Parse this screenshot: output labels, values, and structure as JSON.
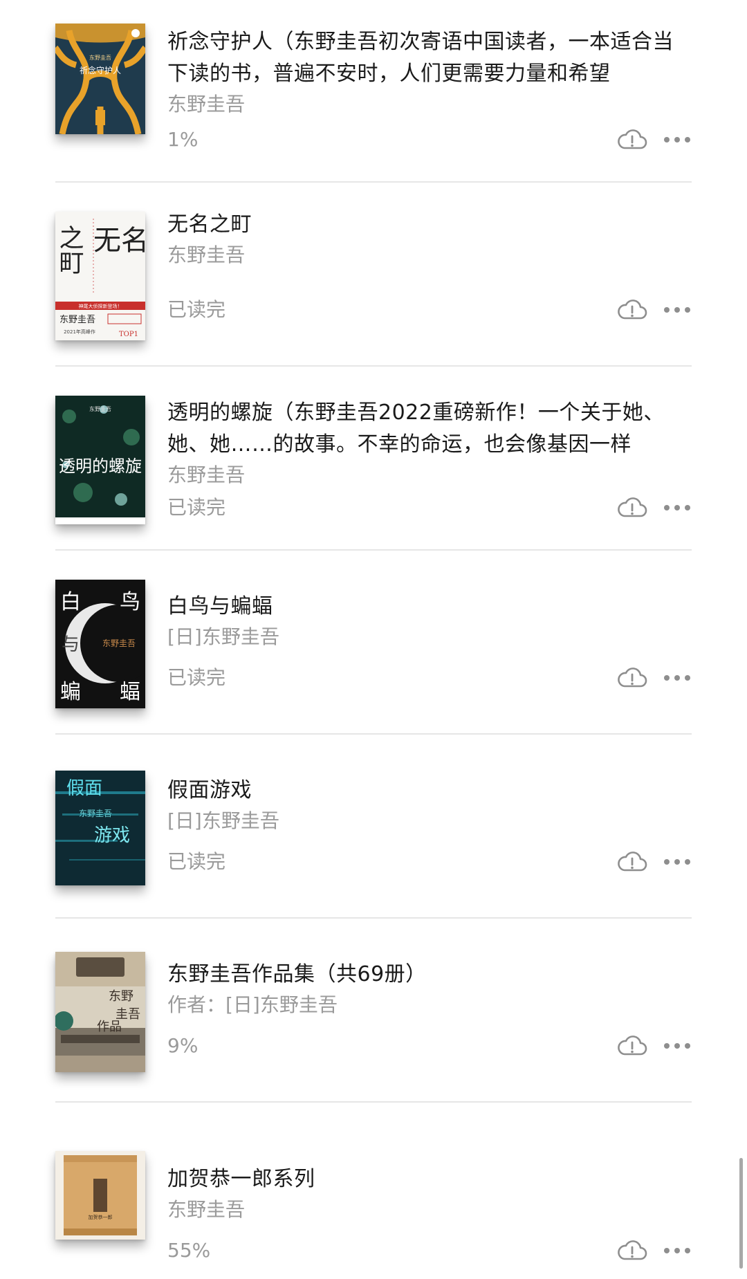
{
  "books": [
    {
      "title": "祈念守护人（东野圭吾初次寄语中国读者，一本适合当下读的书，普遍不安时，人们更需要力量和希望",
      "author": "东野圭吾",
      "progress": "1%",
      "cover": {
        "text_top": "东野圭吾",
        "text_main": "祈念守护人"
      }
    },
    {
      "title": "无名之町",
      "author": "东野圭吾",
      "progress": "已读完",
      "cover": {
        "text_right": "无名",
        "text_left": "之町",
        "band": "神尾大侦探新登场！",
        "author": "东野圭吾",
        "tag": "2021年高峰作",
        "badge": "TOP1"
      }
    },
    {
      "title": "透明的螺旋（东野圭吾2022重磅新作！一个关于她、她、她……的故事。不幸的命运，也会像基因一样",
      "author": "东野圭吾",
      "progress": "已读完",
      "cover": {
        "text_top": "东野圭吾",
        "text_main": "透明的螺旋"
      }
    },
    {
      "title": "白鸟与蝙蝠",
      "author": "[日]东野圭吾",
      "progress": "已读完",
      "cover": {
        "text_a": "白",
        "text_b": "鸟",
        "text_c": "与",
        "text_d": "蝙",
        "text_e": "蝠",
        "author": "东野圭吾"
      }
    },
    {
      "title": "假面游戏",
      "author": "[日]东野圭吾",
      "progress": "已读完",
      "cover": {
        "text_top": "假面",
        "text_mid": "东野圭吾",
        "text_bottom": "游戏"
      }
    },
    {
      "title": "东野圭吾作品集（共69册）",
      "author": "作者：[日]东野圭吾",
      "progress": "9%",
      "cover": {
        "text_v1": "东野",
        "text_v2": "圭吾",
        "text_v3": "作品"
      }
    },
    {
      "title": "加贺恭一郎系列",
      "author": "东野圭吾",
      "progress": "55%",
      "cover": {
        "label": "加贺恭一郎"
      }
    }
  ],
  "icons": {
    "cloud": "cloud-alert-icon",
    "more": "more-dots-icon"
  },
  "colors": {
    "text_primary": "#1a1a1a",
    "text_secondary": "#9a9a9a",
    "divider": "#e6e6e6",
    "icon": "#8e8e8e"
  }
}
